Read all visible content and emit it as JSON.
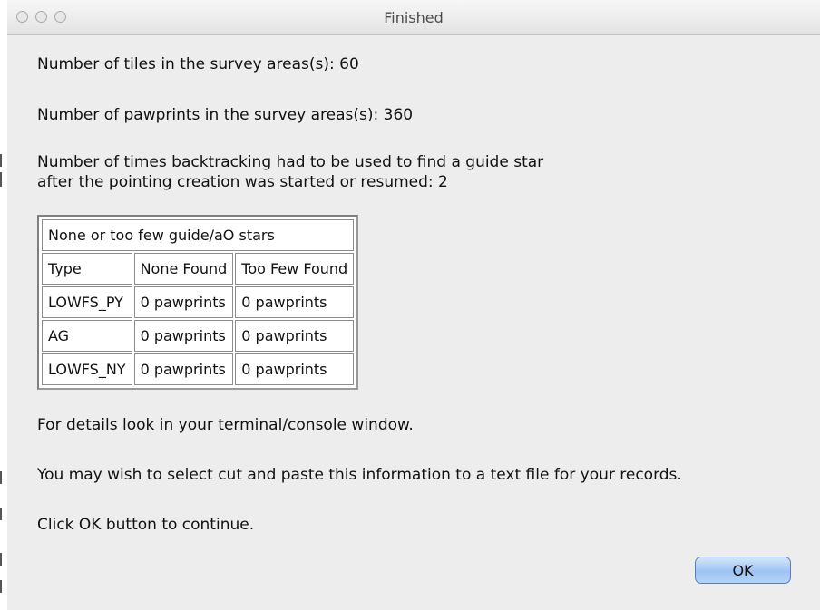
{
  "window": {
    "title": "Finished"
  },
  "messages": {
    "tiles": "Number of tiles in the survey areas(s): 60",
    "pawprints": "Number of pawprints in the survey areas(s): 360",
    "backtracking_line1": "Number of times backtracking had to be used to find a guide star",
    "backtracking_line2": "after the pointing creation was started or resumed: 2",
    "details": "For details look in your terminal/console window.",
    "records": "You may wish to select cut and paste this information to a text file for your records.",
    "continue": "Click OK button to continue."
  },
  "table": {
    "caption": "None or too few guide/aO stars",
    "headers": [
      "Type",
      "None Found",
      "Too Few Found"
    ],
    "rows": [
      [
        "LOWFS_PY",
        "0 pawprints",
        "0 pawprints"
      ],
      [
        "AG",
        "0 pawprints",
        "0 pawprints"
      ],
      [
        "LOWFS_NY",
        "0 pawprints",
        "0 pawprints"
      ]
    ]
  },
  "buttons": {
    "ok_label": "OK"
  },
  "colors": {
    "window_bg": "#ededed",
    "ok_button": "#9dc3f2"
  }
}
